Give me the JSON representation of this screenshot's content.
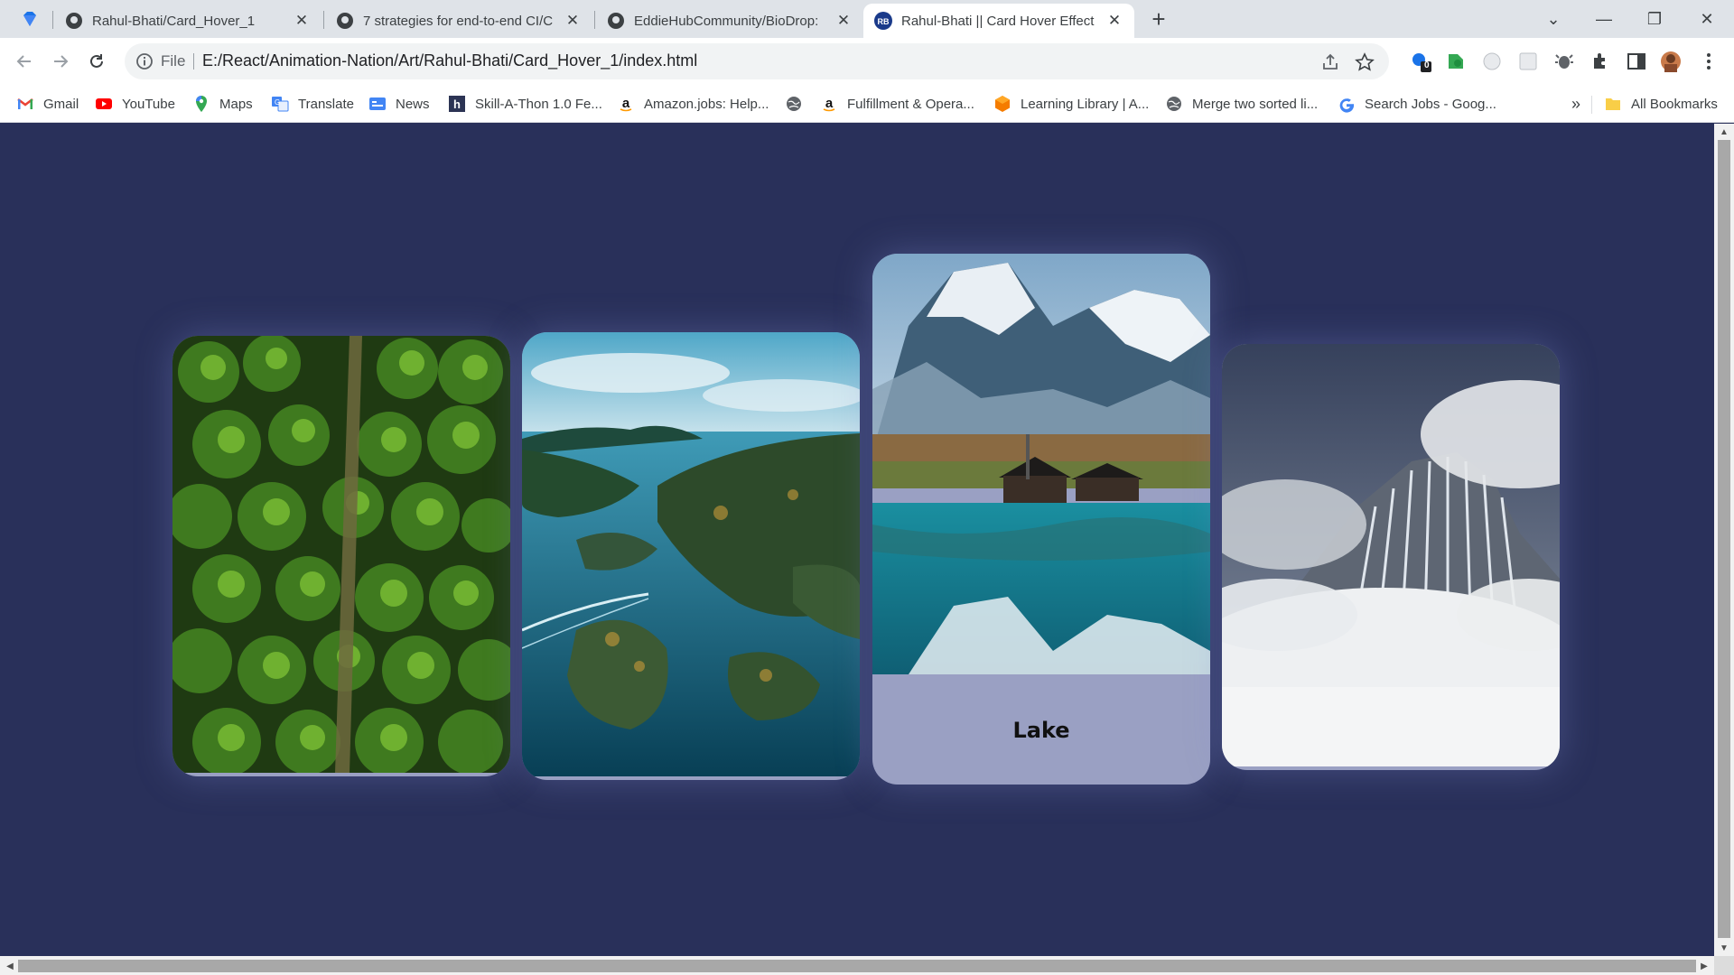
{
  "browser": {
    "tabs": [
      {
        "title": "Rahul-Bhati/Card_Hover_1",
        "icon": "github-icon",
        "active": false
      },
      {
        "title": "7 strategies for end-to-end CI/C",
        "icon": "github-icon",
        "active": false
      },
      {
        "title": "EddieHubCommunity/BioDrop: ",
        "icon": "github-icon",
        "active": false
      },
      {
        "title": "Rahul-Bhati || Card Hover Effect",
        "icon": "rb-favicon",
        "active": true
      }
    ],
    "address": {
      "scheme_label": "File",
      "url": "E:/React/Animation-Nation/Art/Rahul-Bhati/Card_Hover_1/index.html"
    },
    "extension_badge": "0"
  },
  "bookmarks": [
    {
      "label": "Gmail",
      "icon": "gmail-icon"
    },
    {
      "label": "YouTube",
      "icon": "youtube-icon"
    },
    {
      "label": "Maps",
      "icon": "maps-pin-icon"
    },
    {
      "label": "Translate",
      "icon": "translate-icon"
    },
    {
      "label": "News",
      "icon": "news-icon"
    },
    {
      "label": "Skill-A-Thon 1.0 Fe...",
      "icon": "hackerearth-icon"
    },
    {
      "label": "Amazon.jobs: Help...",
      "icon": "amazon-icon"
    },
    {
      "label": "",
      "icon": "globe-icon"
    },
    {
      "label": "Fulfillment & Opera...",
      "icon": "amazon-icon"
    },
    {
      "label": "Learning Library | A...",
      "icon": "hexagon-icon"
    },
    {
      "label": "Merge two sorted li...",
      "icon": "globe-icon"
    },
    {
      "label": "Search Jobs - Goog...",
      "icon": "google-icon"
    }
  ],
  "bookmarks_overflow": "»",
  "all_bookmarks_label": "All Bookmarks",
  "cards": [
    {
      "name": "forest",
      "caption": ""
    },
    {
      "name": "islands",
      "caption": ""
    },
    {
      "name": "lake",
      "caption": "Lake"
    },
    {
      "name": "mountain",
      "caption": ""
    }
  ],
  "colors": {
    "page_background": "#29305a",
    "card_caption_background": "#9aa0c3"
  }
}
